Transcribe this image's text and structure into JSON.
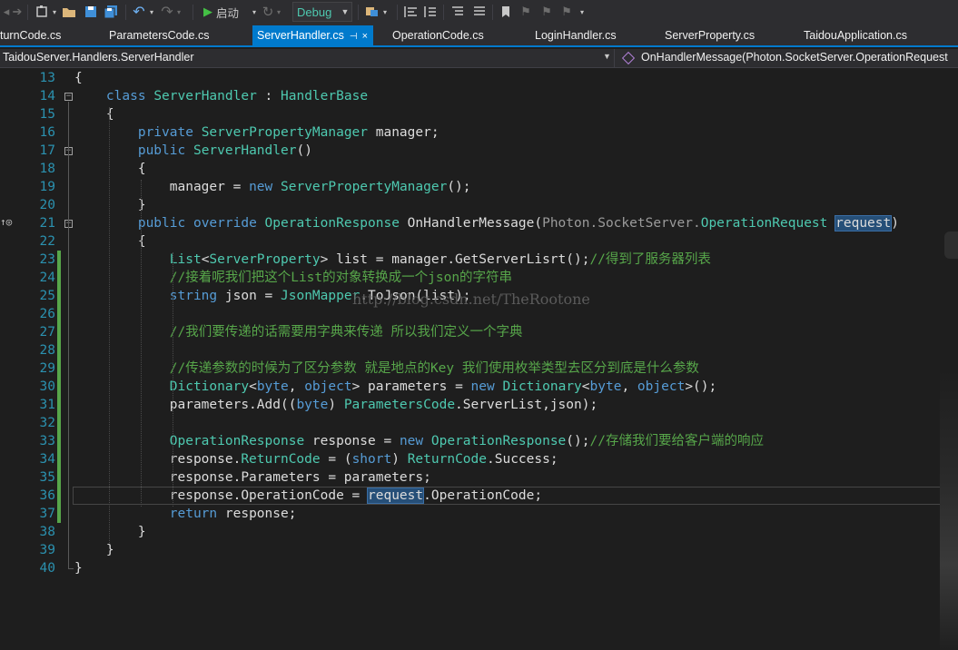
{
  "toolbar": {
    "run_label": "启动",
    "config_value": "Debug"
  },
  "tabs": [
    {
      "label": "turnCode.cs"
    },
    {
      "label": "ParametersCode.cs"
    },
    {
      "label": "ServerHandler.cs",
      "active": true,
      "pin": "⊣",
      "close": "×"
    },
    {
      "label": "OperationCode.cs"
    },
    {
      "label": "LoginHandler.cs"
    },
    {
      "label": "ServerProperty.cs"
    },
    {
      "label": "TaidouApplication.cs"
    }
  ],
  "navbar": {
    "type_scope": "TaidouServer.Handlers.ServerHandler",
    "member_scope": "OnHandlerMessage(Photon.SocketServer.OperationRequest"
  },
  "editor": {
    "line_numbers": [
      "13",
      "14",
      "15",
      "16",
      "17",
      "18",
      "19",
      "20",
      "21",
      "22",
      "23",
      "24",
      "25",
      "26",
      "27",
      "28",
      "29",
      "30",
      "31",
      "32",
      "33",
      "34",
      "35",
      "36",
      "37",
      "38",
      "39",
      "40"
    ],
    "watermark": "http://blog.csdn.net/TheRootone",
    "code_lines": [
      "{",
      "    class ServerHandler : HandlerBase",
      "    {",
      "        private ServerPropertyManager manager;",
      "        public ServerHandler()",
      "        {",
      "            manager = new ServerPropertyManager();",
      "        }",
      "        public override OperationResponse OnHandlerMessage(Photon.SocketServer.OperationRequest request)",
      "        {",
      "            List<ServerProperty> list = manager.GetServerLisrt();//得到了服务器列表",
      "            //接着呢我们把这个List的对象转换成一个json的字符串",
      "            string json = JsonMapper.ToJson(list);",
      "",
      "            //我们要传递的话需要用字典来传递 所以我们定义一个字典",
      "",
      "            //传递参数的时候为了区分参数 就是地点的Key 我们使用枚举类型去区分到底是什么参数",
      "            Dictionary<byte, object> parameters = new Dictionary<byte, object>();",
      "            parameters.Add((byte) ParametersCode.ServerList,json);",
      "",
      "            OperationResponse response = new OperationResponse();//存储我们要给客户端的响应",
      "            response.ReturnCode = (short) ReturnCode.Success;",
      "            response.Parameters = parameters;",
      "            response.OperationCode = request.OperationCode;",
      "            return response;",
      "        }",
      "    }",
      "}"
    ]
  }
}
